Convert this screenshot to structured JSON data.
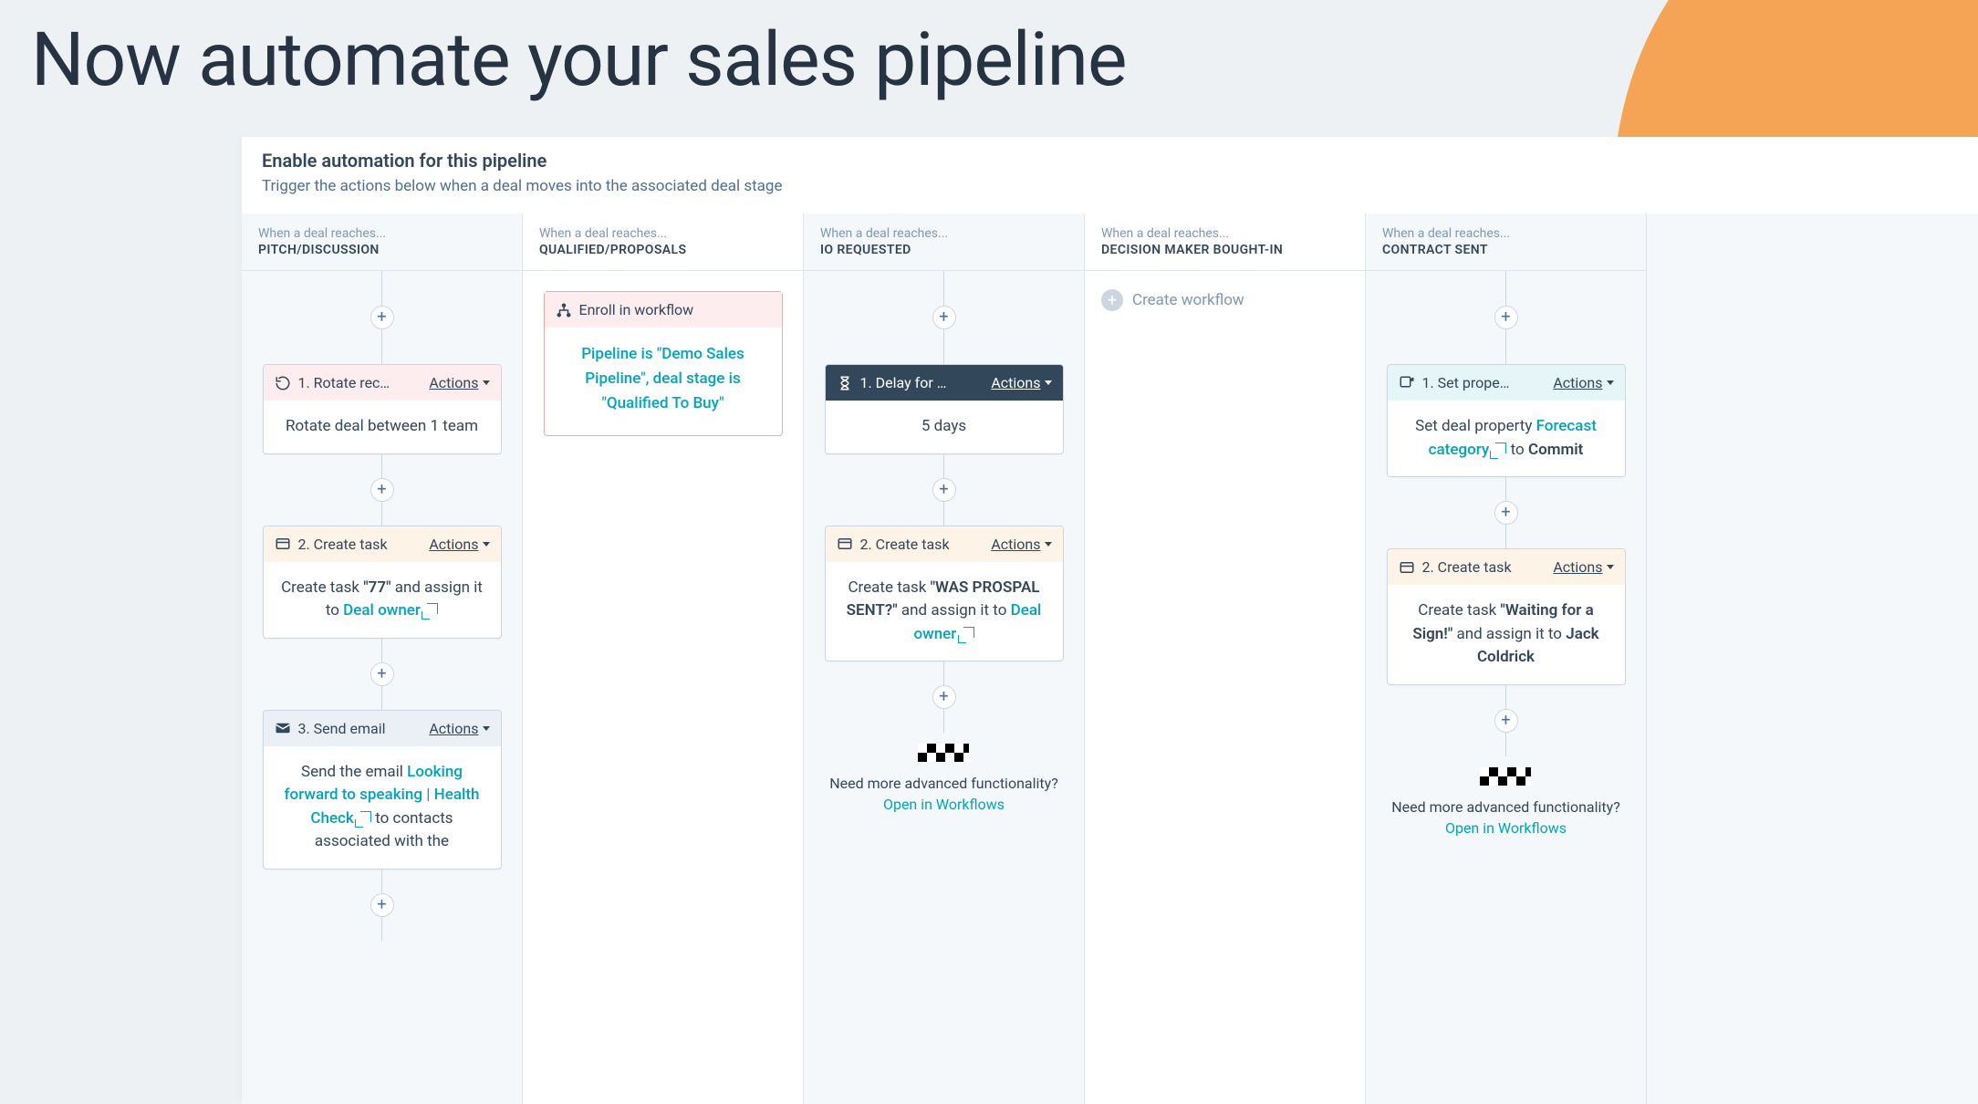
{
  "page": {
    "title": "Now automate your sales pipeline"
  },
  "panel": {
    "heading": "Enable automation for this pipeline",
    "subheading": "Trigger the actions below when a deal moves into the associated deal stage"
  },
  "shared": {
    "when_reaches": "When a deal reaches...",
    "actions_label": "Actions",
    "open_in_workflows": "Open in Workflows",
    "need_more": "Need more advanced functionality?",
    "create_workflow": "Create workflow",
    "enroll_label": "Enroll in workflow"
  },
  "columns": [
    {
      "stage": "PITCH/DISCUSSION",
      "cards": [
        {
          "head_style": "pink",
          "icon": "rotate-icon",
          "title": "1. Rotate rec…",
          "body_html": "Rotate deal between 1 team"
        },
        {
          "head_style": "peach",
          "icon": "task-icon",
          "title": "2. Create task",
          "body_html": "Create task <span class='bold'>\"77\"</span> and assign it to <span class='tealtext'>Deal owner <span class='ext-icon'></span></span>"
        },
        {
          "head_style": "gray",
          "icon": "mail-icon",
          "title": "3. Send email",
          "body_html": "Send the email <span class='tealtext'>Looking forward to speaking | Health Check <span class='ext-icon'></span></span> to contacts associated with the"
        }
      ]
    },
    {
      "stage": "QUALIFIED/PROPOSALS",
      "enroll_text": "Pipeline is \"Demo Sales Pipeline\", deal stage is \"Qualified To Buy\""
    },
    {
      "stage": "IO REQUESTED",
      "cards": [
        {
          "head_style": "dark",
          "icon": "delay-icon",
          "title": "1. Delay for …",
          "body_html": "5 days"
        },
        {
          "head_style": "peach",
          "icon": "task-icon",
          "title": "2. Create task",
          "body_html": "Create task <span class='bold'>\"WAS PROSPAL SENT?\"</span> and assign it to <span class='tealtext'>Deal owner <span class='ext-icon'></span></span>"
        }
      ],
      "finish": true
    },
    {
      "stage": "DECISION MAKER BOUGHT-IN",
      "empty": true
    },
    {
      "stage": "CONTRACT SENT",
      "cards": [
        {
          "head_style": "teal",
          "icon": "property-icon",
          "title": "1. Set prope…",
          "body_html": "Set deal property <span class='tealtext'>Forecast category <span class='ext-icon'></span></span> to <span class='bold'>Commit</span>"
        },
        {
          "head_style": "peach",
          "icon": "task-icon",
          "title": "2. Create task",
          "body_html": "Create task <span class='bold'>\"Waiting for a Sign!\"</span> and assign it to <span class='bold'>Jack Coldrick</span>"
        }
      ],
      "finish": true
    }
  ]
}
